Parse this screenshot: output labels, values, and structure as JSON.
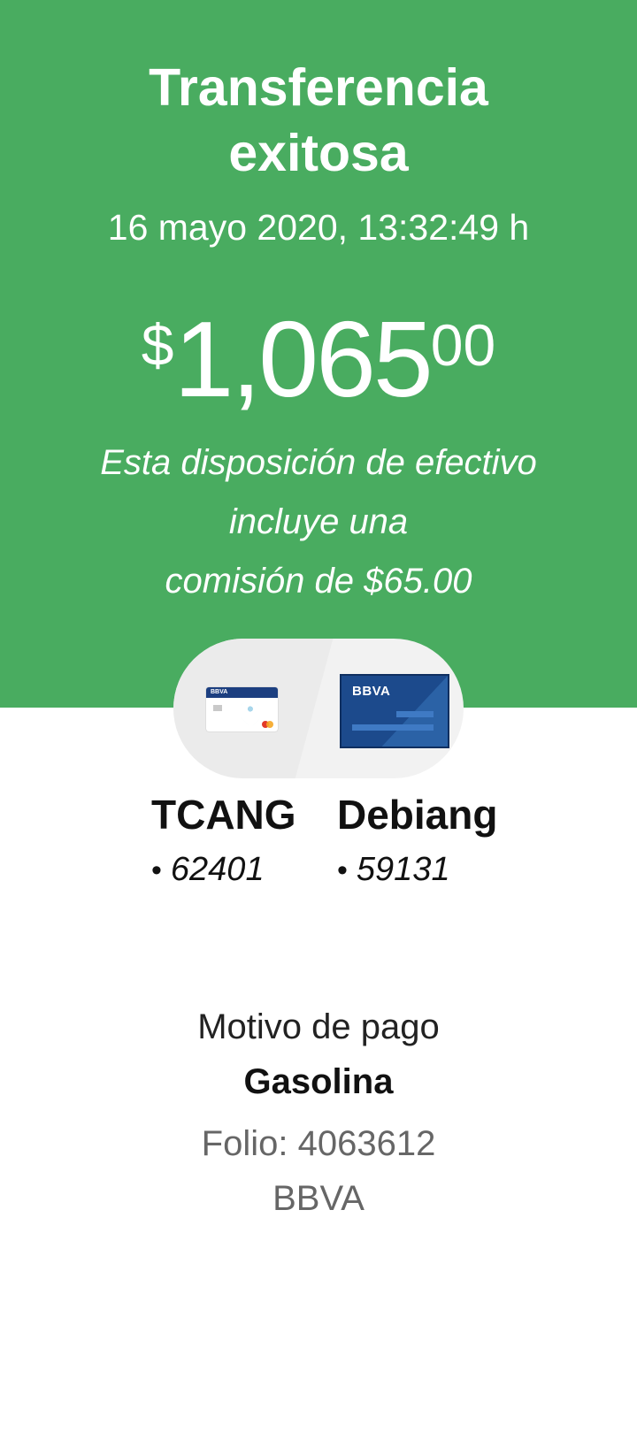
{
  "header": {
    "title_line1": "Transferencia",
    "title_line2": "exitosa",
    "datetime": "16 mayo 2020, 13:32:49 h",
    "amount": {
      "currency": "$",
      "integer": "1,065",
      "cents": "00"
    },
    "note_line1": "Esta disposición de efectivo",
    "note_line2": "incluye una",
    "note_line3": "comisión de $65.00",
    "background_color": "#49ac60"
  },
  "origin_account": {
    "card_brand": "BBVA",
    "name": "TCANG",
    "bullet": "•",
    "number": "62401"
  },
  "destination_account": {
    "card_brand": "BBVA",
    "name": "Debiang",
    "bullet": "•",
    "number": "59131"
  },
  "details": {
    "motivo_label": "Motivo de pago",
    "motivo_value": "Gasolina",
    "folio": "Folio: 4063612",
    "bank": "BBVA"
  }
}
